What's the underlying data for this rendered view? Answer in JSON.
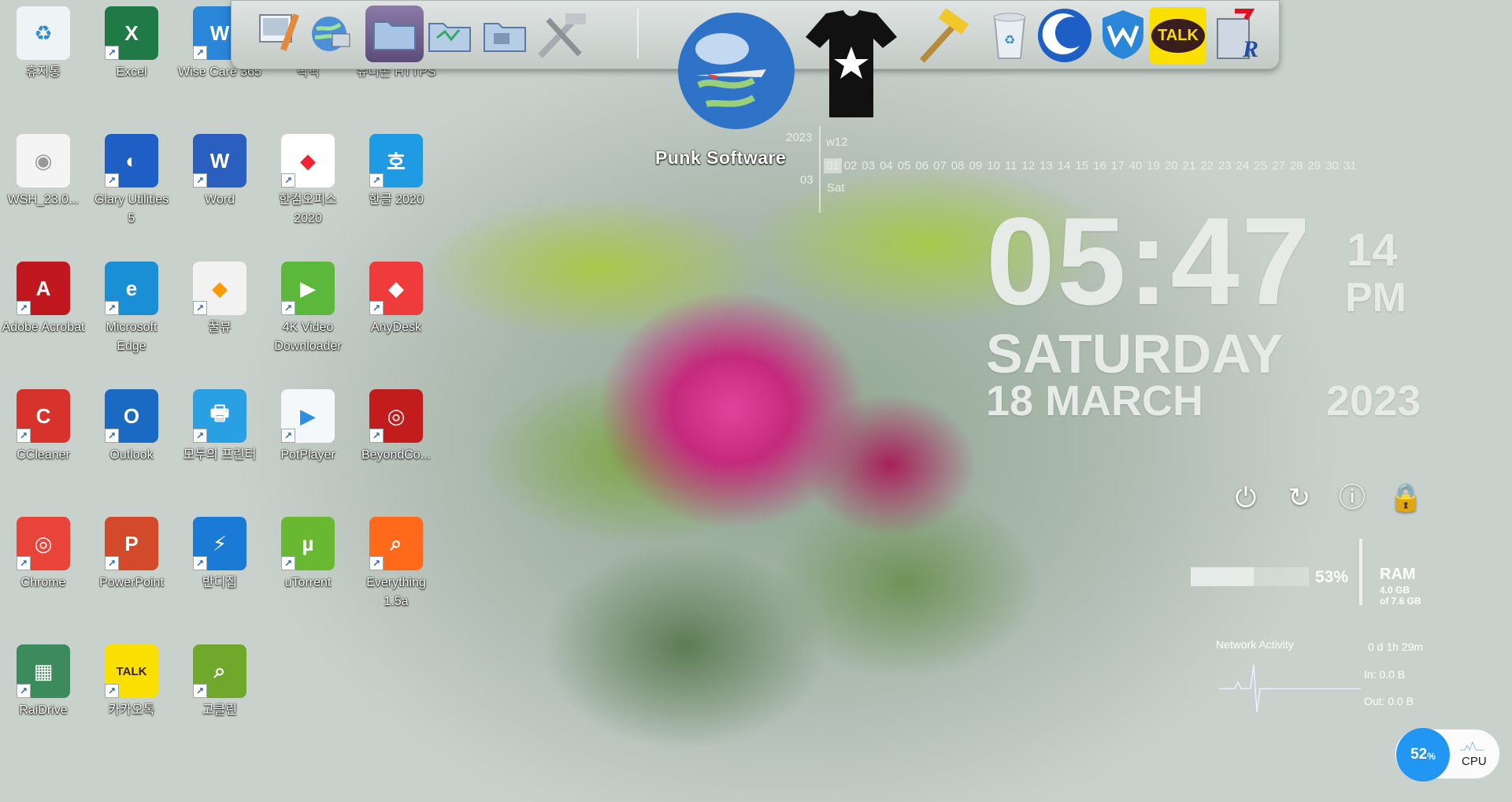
{
  "desktop_icons": [
    {
      "label": "휴지통",
      "icon": "recycle-bin-icon"
    },
    {
      "label": "Excel",
      "icon": "excel-icon"
    },
    {
      "label": "Wise Care 365",
      "icon": "wise-care-icon"
    },
    {
      "label": "픽픽",
      "icon": "picpick-icon"
    },
    {
      "label": "유니콘 HTTPS",
      "icon": "unicorn-https-icon"
    },
    {
      "label": "WSH_23.0...",
      "icon": "file-icon"
    },
    {
      "label": "Glary Utilities 5",
      "icon": "glary-utilities-icon"
    },
    {
      "label": "Word",
      "icon": "word-icon"
    },
    {
      "label": "한컴오피스 2020",
      "icon": "hancom-office-icon"
    },
    {
      "label": "한글 2020",
      "icon": "hangul-icon"
    },
    {
      "label": "Adobe Acrobat",
      "icon": "adobe-acrobat-icon"
    },
    {
      "label": "Microsoft Edge",
      "icon": "edge-icon"
    },
    {
      "label": "꿀뷰",
      "icon": "honeyview-icon"
    },
    {
      "label": "4K Video Downloader",
      "icon": "4k-video-downloader-icon"
    },
    {
      "label": "AnyDesk",
      "icon": "anydesk-icon"
    },
    {
      "label": "CCleaner",
      "icon": "ccleaner-icon"
    },
    {
      "label": "Outlook",
      "icon": "outlook-icon"
    },
    {
      "label": "모두의 프린터",
      "icon": "printer-icon"
    },
    {
      "label": "PotPlayer",
      "icon": "potplayer-icon"
    },
    {
      "label": "BeyondCo...",
      "icon": "beyond-compare-icon"
    },
    {
      "label": "Chrome",
      "icon": "chrome-icon"
    },
    {
      "label": "PowerPoint",
      "icon": "powerpoint-icon"
    },
    {
      "label": "반디집",
      "icon": "bandizip-icon"
    },
    {
      "label": "uTorrent",
      "icon": "utorrent-icon"
    },
    {
      "label": "Everything 1.5a",
      "icon": "everything-icon"
    },
    {
      "label": "RaiDrive",
      "icon": "raidrive-icon"
    },
    {
      "label": "카카오톡",
      "icon": "kakaotalk-icon"
    },
    {
      "label": "고클린",
      "icon": "goclean-icon"
    }
  ],
  "dock": {
    "items": [
      "display-settings-icon",
      "network-globe-icon",
      "folder-icon",
      "folder-icon",
      "folder-icon",
      "tools-icon",
      "punk-software-globe-icon",
      "tshirt-icon",
      "hammer-icon",
      "recycle-bin-icon",
      "glary-icon",
      "wise-care-icon",
      "kakaotalk-icon",
      "registry-icon"
    ],
    "kakao_text": "TALK",
    "punk_label": "Punk Software"
  },
  "calendar": {
    "year": "2023",
    "week": "w12",
    "month": "03",
    "day_name": "Sat",
    "days": [
      "01",
      "02",
      "03",
      "04",
      "05",
      "06",
      "07",
      "08",
      "09",
      "10",
      "11",
      "12",
      "13",
      "14",
      "15",
      "16",
      "17",
      "40",
      "19",
      "20",
      "21",
      "22",
      "23",
      "24",
      "25",
      "27",
      "28",
      "29",
      "30",
      "31"
    ],
    "selected": "01"
  },
  "clock": {
    "time": "05:47",
    "seconds": "14",
    "ampm": "PM",
    "weekday": "SATURDAY",
    "date": "18 MARCH",
    "year": "2023"
  },
  "system_buttons": [
    "power-icon",
    "restart-icon",
    "shutdown-icon",
    "lock-icon"
  ],
  "ram": {
    "percent_text": "53%",
    "label": "RAM",
    "used": "4.0 GB",
    "total": "of 7.6 GB",
    "fill": 0.53
  },
  "network": {
    "title": "Network Activity",
    "uptime": "0 d 1h 29m",
    "in": "In: 0.0 B",
    "out": "Out: 0.0 B"
  },
  "cpu": {
    "percent": "52",
    "unit": "%",
    "label": "CPU"
  }
}
